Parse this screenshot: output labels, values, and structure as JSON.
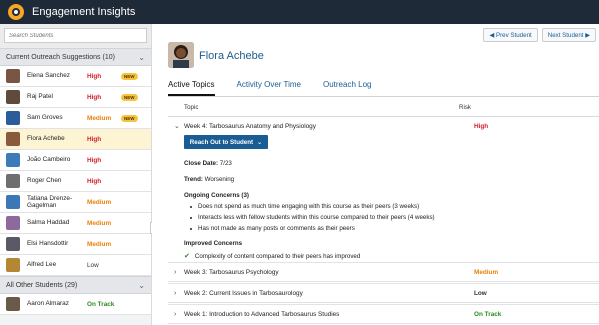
{
  "app": {
    "title": "Engagement Insights"
  },
  "sidebar": {
    "search_placeholder": "Search Students",
    "suggestions_header": "Current Outreach Suggestions (10)",
    "other_header": "All Other Students (29)",
    "students": [
      {
        "name": "Elena Sanchez",
        "risk": "High",
        "risk_class": "high",
        "badge": "NEW",
        "avatar_color": "#7a5544"
      },
      {
        "name": "Raj Patel",
        "risk": "High",
        "risk_class": "high",
        "badge": "NEW",
        "avatar_color": "#5e4b3c"
      },
      {
        "name": "Sam Groves",
        "risk": "Medium",
        "risk_class": "medium",
        "badge": "NEW",
        "avatar_color": "#2c5d9a"
      },
      {
        "name": "Flora Achebe",
        "risk": "High",
        "risk_class": "high",
        "badge": "",
        "avatar_color": "#8a5a3c"
      },
      {
        "name": "João Cambeiro",
        "risk": "High",
        "risk_class": "high",
        "badge": "",
        "avatar_color": "#3d7ab8"
      },
      {
        "name": "Roger Chen",
        "risk": "High",
        "risk_class": "high",
        "badge": "",
        "avatar_color": "#6f6f6f"
      },
      {
        "name": "Tatiana Drenze-Gagelman",
        "risk": "Medium",
        "risk_class": "medium",
        "badge": "",
        "avatar_color": "#3b78b5"
      },
      {
        "name": "Salma Haddad",
        "risk": "Medium",
        "risk_class": "medium",
        "badge": "",
        "avatar_color": "#8c6a9e"
      },
      {
        "name": "Elsi Hansdottir",
        "risk": "Medium",
        "risk_class": "medium",
        "badge": "",
        "avatar_color": "#5a5a66"
      },
      {
        "name": "Alfred Lee",
        "risk": "Low",
        "risk_class": "low",
        "badge": "",
        "avatar_color": "#b38733"
      }
    ],
    "other_students": [
      {
        "name": "Aaron Almaraz",
        "risk": "On Track",
        "risk_class": "ontrack",
        "badge": "",
        "avatar_color": "#6b5a4a"
      }
    ]
  },
  "main": {
    "student_name": "Flora Achebe",
    "prev_label": "Prev Student",
    "next_label": "Next Student",
    "tabs": [
      "Active Topics",
      "Activity Over Time",
      "Outreach Log"
    ],
    "col_topic": "Topic",
    "col_risk": "Risk",
    "expanded": {
      "topic": "Week 4: Tarbosaurus Anatomy and Physiology",
      "risk": "High",
      "reach_label": "Reach Out to Student",
      "close_label": "Close Date:",
      "close_value": "7/23",
      "trend_label": "Trend:",
      "trend_value": "Worsening",
      "concerns_title": "Ongoing Concerns (3)",
      "concerns": [
        "Does not spend as much time engaging with this course as their peers (3 weeks)",
        "Interacts less with fellow students within this course compared to their peers (4 weeks)",
        "Has not made as many posts or comments as their peers"
      ],
      "improved_title": "Improved Concerns",
      "improved": "Complexity of content compared to their peers has improved"
    },
    "rows": [
      {
        "topic": "Week 3: Tarbosaurus Psychology",
        "risk": "Medium",
        "risk_class": "medium"
      },
      {
        "topic": "Week 2: Current Issues in Tarbosaurology",
        "risk": "Low",
        "risk_class": "low"
      },
      {
        "topic": "Week 1: Introduction to Advanced Tarbosaurus Studies",
        "risk": "On Track",
        "risk_class": "ontrack"
      }
    ]
  },
  "colors": {
    "brand": "#1a5c94",
    "topbar": "#1f2a38",
    "high": "#d0202a",
    "medium": "#e6830a",
    "ontrack": "#2b8a1f"
  }
}
